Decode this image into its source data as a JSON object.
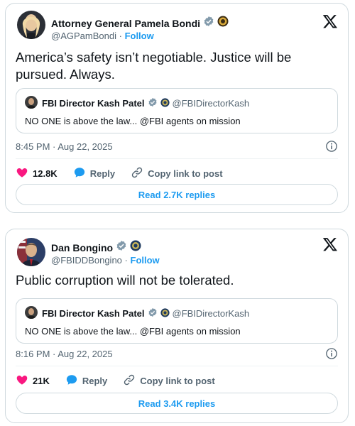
{
  "colors": {
    "accent": "#1d9bf0",
    "like": "#f91880",
    "verified": "#829aab",
    "secondary_text": "#536471",
    "border": "#cfd9de"
  },
  "posts": [
    {
      "author_name": "Attorney General Pamela Bondi",
      "handle": "@AGPamBondi",
      "separator": "·",
      "follow_label": "Follow",
      "text": "America’s safety isn’t negotiable. Justice will be pursued. Always.",
      "quote": {
        "author_name": "FBI Director Kash Patel",
        "handle": "@FBIDirectorKash",
        "text": "NO ONE is above the law... @FBI agents on mission"
      },
      "timestamp": "8:45 PM · Aug 22, 2025",
      "likes": "12.8K",
      "reply_label": "Reply",
      "copy_label": "Copy link to post",
      "replies_button": "Read 2.7K replies"
    },
    {
      "author_name": "Dan Bongino",
      "handle": "@FBIDDBongino",
      "separator": "·",
      "follow_label": "Follow",
      "text": "Public corruption will not be tolerated.",
      "quote": {
        "author_name": "FBI Director Kash Patel",
        "handle": "@FBIDirectorKash",
        "text": "NO ONE is above the law... @FBI agents on mission"
      },
      "timestamp": "8:16 PM · Aug 22, 2025",
      "likes": "21K",
      "reply_label": "Reply",
      "copy_label": "Copy link to post",
      "replies_button": "Read 3.4K replies"
    }
  ]
}
